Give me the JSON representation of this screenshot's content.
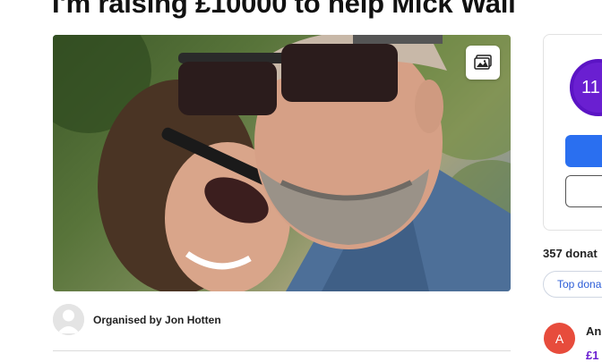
{
  "header": {
    "title": "I'm raising £10000 to help Mick Wall"
  },
  "hero": {
    "image_alt": "Photo of Mick Wall and partner wearing sunglasses",
    "gallery_icon": "image-gallery-icon"
  },
  "organiser": {
    "label": "Organised by Jon Hotten",
    "avatar_icon": "default-user-avatar-icon"
  },
  "sidebar": {
    "progress_text": "11",
    "progress_color": "#6a1fd1",
    "donate_button_color": "#2a6ff0",
    "donations_count": "357 donat",
    "top_donations_label": "Top dona",
    "donor": {
      "initial": "A",
      "name": "An",
      "amount": "£1",
      "avatar_color": "#e74c3c"
    }
  }
}
